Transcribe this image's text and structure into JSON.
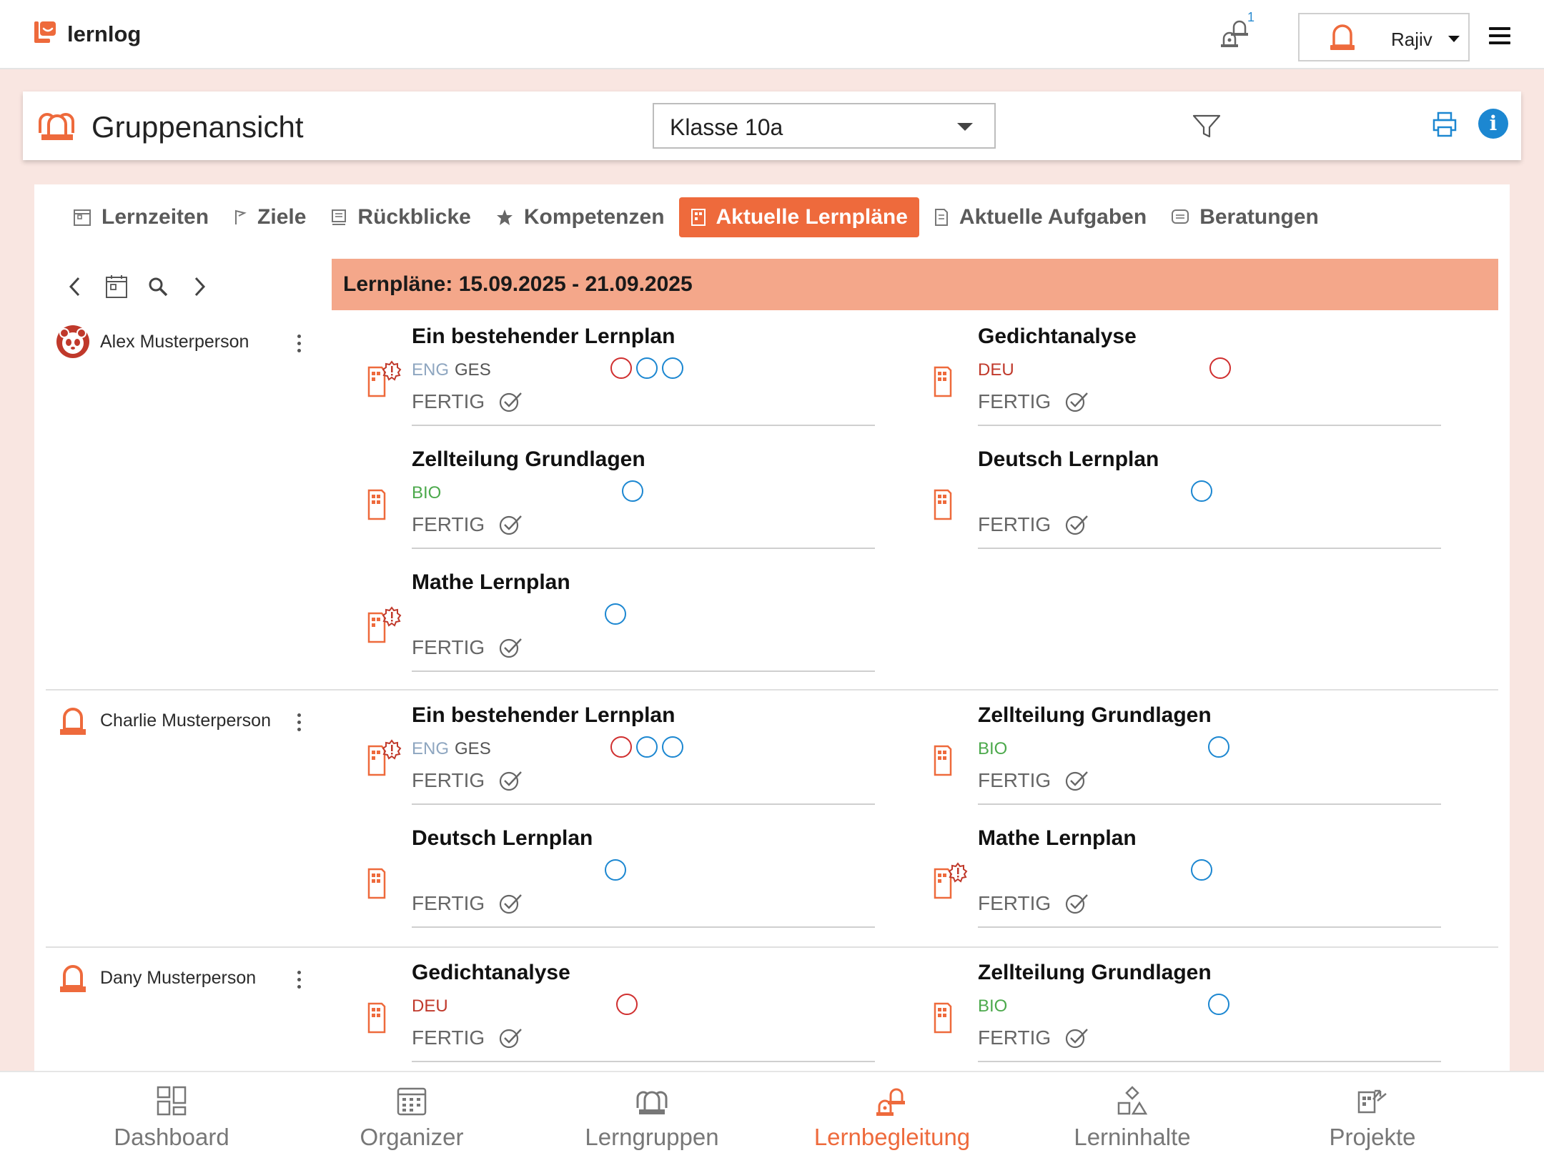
{
  "app": {
    "name": "lernlog"
  },
  "topbar": {
    "notification_count": "1",
    "user_name": "Rajiv"
  },
  "header": {
    "title": "Gruppenansicht",
    "class_select": "Klasse 10a"
  },
  "tabs": [
    {
      "label": "Lernzeiten",
      "icon": "calendar-icon"
    },
    {
      "label": "Ziele",
      "icon": "flag-icon"
    },
    {
      "label": "Rückblicke",
      "icon": "review-icon"
    },
    {
      "label": "Kompetenzen",
      "icon": "star-icon"
    },
    {
      "label": "Aktuelle Lernpläne",
      "icon": "plan-icon",
      "active": true
    },
    {
      "label": "Aktuelle Aufgaben",
      "icon": "task-icon"
    },
    {
      "label": "Beratungen",
      "icon": "chat-icon"
    }
  ],
  "week": {
    "label": "Lernpläne: 15.09.2025 - 21.09.2025"
  },
  "students": [
    {
      "name": "Alex Musterperson",
      "plans": [
        {
          "title": "Ein bestehender Lernplan",
          "status": "FERTIG",
          "alert": true
        },
        {
          "title": "Gedichtanalyse",
          "status": "FERTIG",
          "alert": false
        },
        {
          "title": "Zellteilung Grundlagen",
          "status": "FERTIG",
          "alert": false
        },
        {
          "title": "Deutsch Lernplan",
          "status": "FERTIG",
          "alert": false
        },
        {
          "title": "Mathe Lernplan",
          "status": "FERTIG",
          "alert": true
        }
      ]
    },
    {
      "name": "Charlie Musterperson",
      "plans": [
        {
          "title": "Ein bestehender Lernplan",
          "status": "FERTIG",
          "alert": true
        },
        {
          "title": "Zellteilung Grundlagen",
          "status": "FERTIG",
          "alert": false
        },
        {
          "title": "Deutsch Lernplan",
          "status": "FERTIG",
          "alert": false
        },
        {
          "title": "Mathe Lernplan",
          "status": "FERTIG",
          "alert": true
        }
      ]
    },
    {
      "name": "Dany Musterperson",
      "plans": [
        {
          "title": "Gedichtanalyse",
          "status": "FERTIG",
          "alert": false
        },
        {
          "title": "Zellteilung Grundlagen",
          "status": "FERTIG",
          "alert": false
        }
      ]
    }
  ],
  "subjects": {
    "eng": "ENG",
    "ges": "GES",
    "deu": "DEU",
    "bio": "BIO"
  },
  "bottom_nav": [
    {
      "label": "Dashboard",
      "icon": "dashboard-icon"
    },
    {
      "label": "Organizer",
      "icon": "organizer-icon"
    },
    {
      "label": "Lerngruppen",
      "icon": "groups-icon"
    },
    {
      "label": "Lernbegleitung",
      "icon": "coaching-icon",
      "active": true
    },
    {
      "label": "Lerninhalte",
      "icon": "content-icon"
    },
    {
      "label": "Projekte",
      "icon": "projects-icon"
    }
  ],
  "colors": {
    "accent": "#ee6a3c",
    "banner": "#f4a78a",
    "background": "#f9e6e1",
    "info": "#1c87d1"
  }
}
